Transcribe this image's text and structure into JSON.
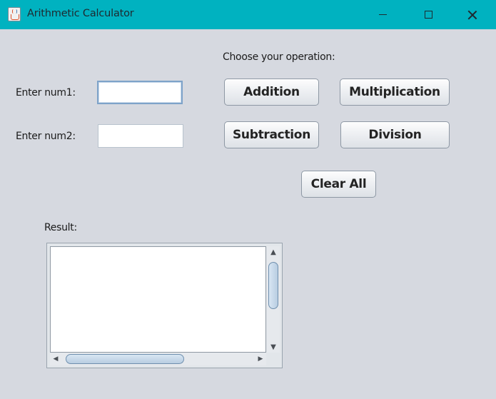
{
  "window": {
    "title": "Arithmetic Calculator",
    "app_icon": "java-cup-icon",
    "controls": [
      "minimize-icon",
      "maximize-icon",
      "close-icon"
    ]
  },
  "inputs": {
    "num1": {
      "label": "Enter num1:",
      "value": "",
      "placeholder": ""
    },
    "num2": {
      "label": "Enter num2:",
      "value": "",
      "placeholder": ""
    }
  },
  "operations": {
    "prompt": "Choose your operation:",
    "addition": "Addition",
    "multiplication": "Multiplication",
    "subtraction": "Subtraction",
    "division": "Division",
    "clear_all": "Clear All"
  },
  "result": {
    "label": "Result:",
    "text": ""
  },
  "colors": {
    "titlebar": "#00b2c0",
    "background": "#d6d9e0"
  }
}
